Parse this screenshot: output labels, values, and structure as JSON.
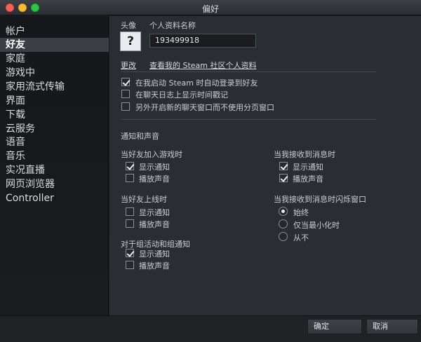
{
  "window": {
    "title": "偏好"
  },
  "sidebar": {
    "items": [
      {
        "label": "帐户",
        "active": false
      },
      {
        "label": "好友",
        "active": true
      },
      {
        "label": "家庭",
        "active": false
      },
      {
        "label": "游戏中",
        "active": false
      },
      {
        "label": "家用流式传输",
        "active": false
      },
      {
        "label": "界面",
        "active": false
      },
      {
        "label": "下载",
        "active": false
      },
      {
        "label": "云服务",
        "active": false
      },
      {
        "label": "语音",
        "active": false
      },
      {
        "label": "音乐",
        "active": false
      },
      {
        "label": "实况直播",
        "active": false
      },
      {
        "label": "网页浏览器",
        "active": false
      },
      {
        "label": "Controller",
        "active": false
      }
    ]
  },
  "profile": {
    "avatar_label": "头像",
    "avatar_glyph": "?",
    "name_label": "个人资料名称",
    "name_value": "193499918",
    "change_link": "更改",
    "view_profile_link": "查看我的 Steam 社区个人资料"
  },
  "general": {
    "auto_login": {
      "label": "在我启动 Steam 时自动登录到好友",
      "checked": true
    },
    "timestamps": {
      "label": "在聊天日志上显示时间戳记",
      "checked": false
    },
    "separate_windows": {
      "label": "另外开启新的聊天窗口而不使用分页窗口",
      "checked": false
    }
  },
  "notifications": {
    "heading": "通知和声音",
    "friend_joins_game": {
      "label": "当好友加入游戏时",
      "show": {
        "label": "显示通知",
        "checked": true
      },
      "sound": {
        "label": "播放声音",
        "checked": false
      }
    },
    "receive_message": {
      "label": "当我接收到消息时",
      "show": {
        "label": "显示通知",
        "checked": true
      },
      "sound": {
        "label": "播放声音",
        "checked": true
      }
    },
    "friend_online": {
      "label": "当好友上线时",
      "show": {
        "label": "显示通知",
        "checked": false
      },
      "sound": {
        "label": "播放声音",
        "checked": false
      }
    },
    "flash_window": {
      "label": "当我接收到消息时闪烁窗口",
      "options": [
        {
          "label": "始终",
          "checked": true
        },
        {
          "label": "仅当最小化时",
          "checked": false
        },
        {
          "label": "从不",
          "checked": false
        }
      ]
    },
    "group_events": {
      "label": "对于组活动和组通知",
      "show": {
        "label": "显示通知",
        "checked": true
      },
      "sound": {
        "label": "播放声音",
        "checked": false
      }
    }
  },
  "footer": {
    "ok_label": "确定",
    "cancel_label": "取消"
  },
  "colors": {
    "background": "#2a2d32",
    "sidebar": "#15171a",
    "active_item": "#3b3f45",
    "text": "#c9ced4"
  }
}
